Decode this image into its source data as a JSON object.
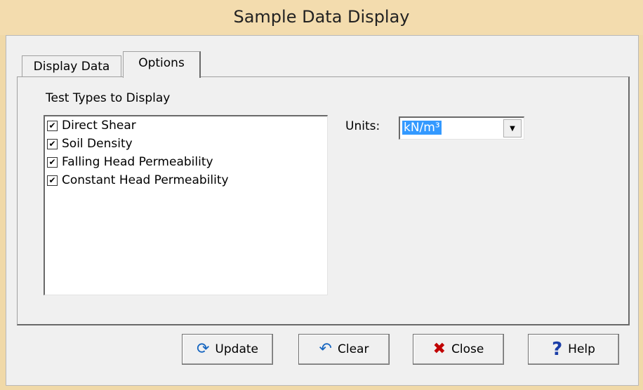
{
  "window": {
    "title": "Sample Data Display"
  },
  "tabs": [
    {
      "label": "Display Data"
    },
    {
      "label": "Options"
    }
  ],
  "options": {
    "group_label": "Test Types to Display",
    "test_types": [
      {
        "label": "Direct Shear",
        "checked": true
      },
      {
        "label": "Soil Density",
        "checked": true
      },
      {
        "label": "Falling Head Permeability",
        "checked": true
      },
      {
        "label": "Constant Head Permeability",
        "checked": true
      }
    ],
    "units_label": "Units:",
    "units_value": "kN/m³"
  },
  "buttons": {
    "update": {
      "label": "Update",
      "icon": "refresh-icon"
    },
    "clear": {
      "label": "Clear",
      "icon": "undo-icon"
    },
    "close": {
      "label": "Close",
      "icon": "close-icon"
    },
    "help": {
      "label": "Help",
      "icon": "help-icon"
    }
  },
  "colors": {
    "title_bar": "#f3dcae",
    "selection": "#3399ff"
  }
}
